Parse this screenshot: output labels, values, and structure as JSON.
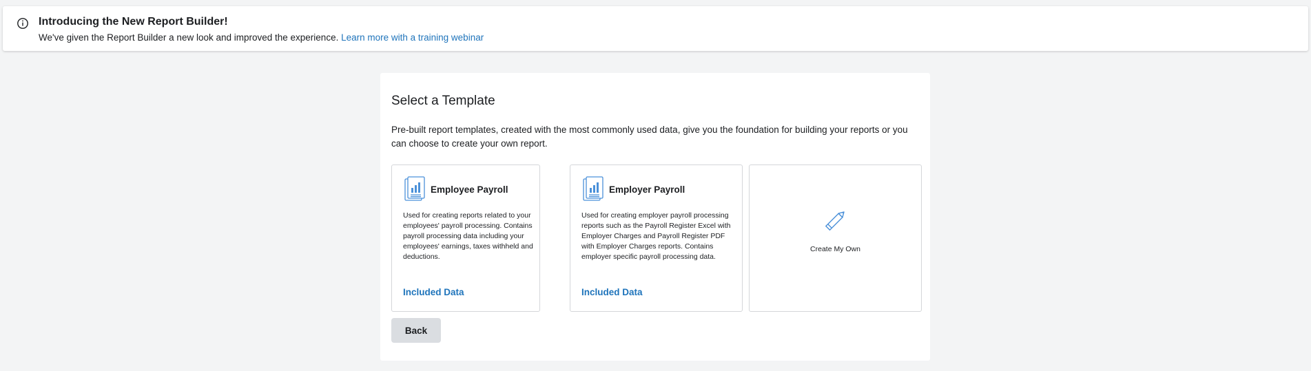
{
  "banner": {
    "icon": "info-circle-icon",
    "title": "Introducing the New Report Builder!",
    "text": "We've given the Report Builder a new look and improved the experience. ",
    "link_label": "Learn more with a training webinar"
  },
  "template_panel": {
    "title": "Select a Template",
    "description": "Pre-built report templates, created with the most commonly used data, give you the foundation for building your reports or you can choose to create your own report.",
    "templates": [
      {
        "icon": "report-chart-icon",
        "title": "Employee Payroll",
        "description": "Used for creating reports related to your employees' payroll processing. Contains payroll processing data including your employees' earnings, taxes withheld and deductions.",
        "link_label": "Included Data"
      },
      {
        "icon": "report-chart-icon",
        "title": "Employer Payroll",
        "description": "Used for creating employer payroll processing reports such as the Payroll Register Excel with Employer Charges and Payroll Register PDF with Employer Charges reports. Contains employer specific payroll processing data.",
        "link_label": "Included Data"
      }
    ],
    "create_own": {
      "icon": "pencil-icon",
      "label": "Create My Own"
    },
    "back_label": "Back"
  },
  "colors": {
    "accent": "#1f74bb",
    "icon_blue": "#4a90d9",
    "background": "#f3f4f5",
    "button_gray": "#dadde1"
  }
}
